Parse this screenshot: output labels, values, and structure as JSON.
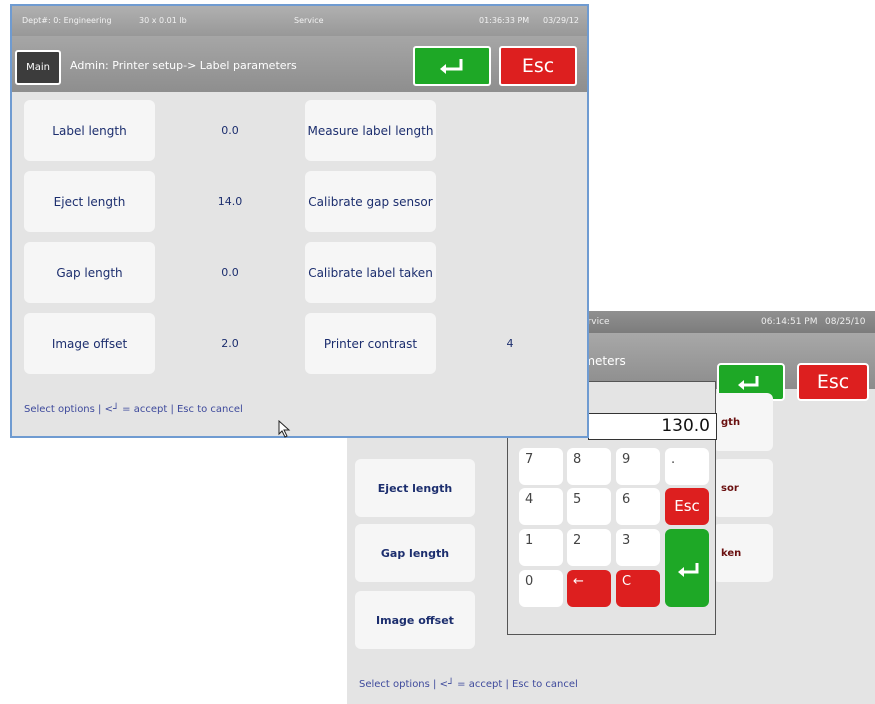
{
  "front_screen": {
    "status": {
      "dept": "Dept#: 0: Engineering",
      "scale": "30 x 0.01 lb",
      "mode": "Service",
      "time": "01:36:33 PM",
      "date": "03/29/12"
    },
    "title": {
      "main_label": "Main",
      "breadcrumb": "Admin: Printer setup-> Label parameters",
      "esc_label": "Esc"
    },
    "params": [
      {
        "label": "Label length",
        "value": "0.0",
        "action": "Measure label length",
        "action_value": ""
      },
      {
        "label": "Eject length",
        "value": "14.0",
        "action": "Calibrate gap sensor",
        "action_value": ""
      },
      {
        "label": "Gap length",
        "value": "0.0",
        "action": "Calibrate label taken",
        "action_value": ""
      },
      {
        "label": "Image offset",
        "value": "2.0",
        "action": "Printer contrast",
        "action_value": "4"
      }
    ],
    "footer": "Select options | <┘ = accept | Esc to cancel"
  },
  "back_screen": {
    "status": {
      "mode_partial": "ervice",
      "time": "06:14:51 PM",
      "date": "08/25/10"
    },
    "title_partial": "ameters",
    "esc_label": "Esc",
    "buttons": [
      "Eject length",
      "Gap length",
      "Image offset"
    ],
    "peek_labels": [
      "gth",
      "sor",
      "ken"
    ],
    "footer": "Select options | <┘ = accept | Esc to cancel",
    "keypad": {
      "display": "130.0",
      "digits": [
        "7",
        "8",
        "9",
        "4",
        "5",
        "6",
        "1",
        "2",
        "3",
        "0"
      ],
      "dot": ".",
      "esc": "Esc",
      "backspace": "←",
      "clear": "C"
    }
  },
  "colors": {
    "enter_green": "#1ea826",
    "esc_red": "#dd1f1f",
    "label_text": "#1c2e6e",
    "footer_text": "#3e4a9c"
  },
  "icons": {
    "enter": "enter-arrow-icon",
    "backspace": "backspace-arrow-icon",
    "cursor": "mouse-pointer-icon"
  }
}
